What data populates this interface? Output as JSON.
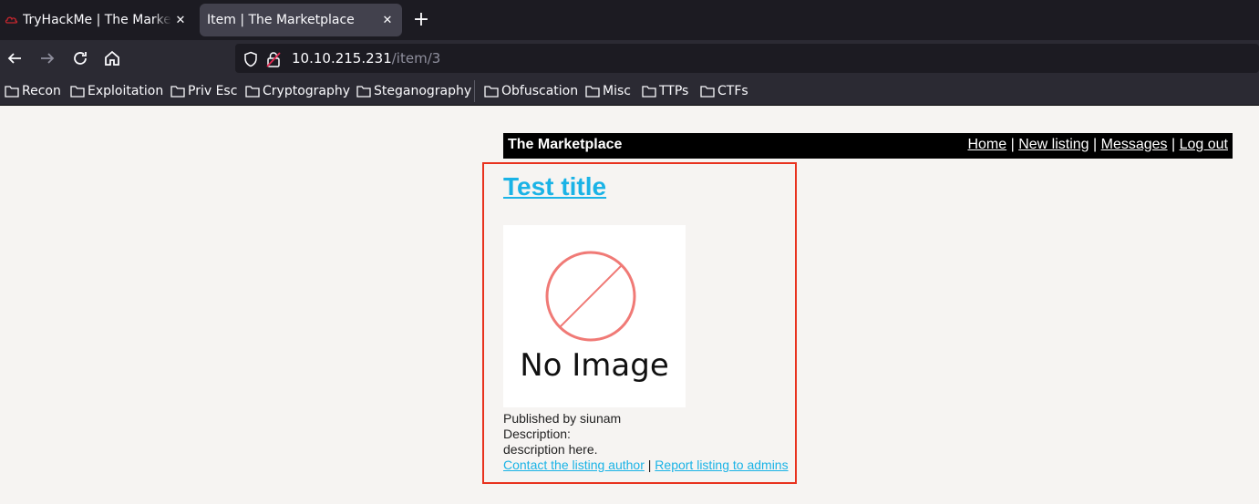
{
  "browser": {
    "tabs": [
      {
        "title": "TryHackMe | The Marketplace",
        "active": false
      },
      {
        "title": "Item | The Marketplace",
        "active": true
      }
    ],
    "url": {
      "host": "10.10.215.231",
      "path": "/item/3"
    },
    "bookmarks": [
      "Recon",
      "Exploitation",
      "Priv Esc",
      "Cryptography",
      "Steganography",
      "Obfuscation",
      "Misc",
      "TTPs",
      "CTFs"
    ]
  },
  "site": {
    "brand": "The Marketplace",
    "nav": [
      "Home",
      "New listing",
      "Messages",
      "Log out"
    ],
    "nav_separator": "|"
  },
  "item": {
    "title": "Test title",
    "image_text": "No Image",
    "published_by": "Published by siunam",
    "description_label": "Description:",
    "description": "description here.",
    "contact_link": "Contact the listing author",
    "report_link": "Report listing to admins",
    "link_separator": "|"
  },
  "colors": {
    "link": "#1ab3e6",
    "highlight_border": "#e8321e",
    "header_bg": "#000000",
    "page_bg": "#f6f4f2"
  }
}
